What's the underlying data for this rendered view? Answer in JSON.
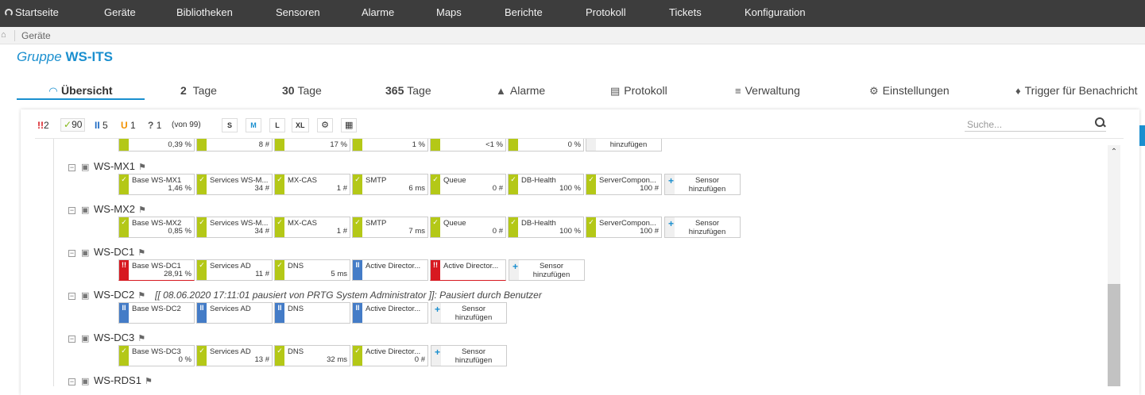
{
  "nav": {
    "home": "Startseite",
    "items": [
      "Geräte",
      "Bibliotheken",
      "Sensoren",
      "Alarme",
      "Maps",
      "Berichte",
      "Protokoll",
      "Tickets",
      "Konfiguration"
    ]
  },
  "breadcrumb": {
    "current": "Geräte"
  },
  "group": {
    "prefix": "Gruppe",
    "name": "WS-ITS"
  },
  "tabs": {
    "overview": "Übersicht",
    "days2_num": "2",
    "days2_label": "Tage",
    "days30_num": "30",
    "days30_label": "Tage",
    "days365_num": "365",
    "days365_label": "Tage",
    "alarms": "Alarme",
    "log": "Protokoll",
    "management": "Verwaltung",
    "settings": "Einstellungen",
    "triggers": "Trigger für Benachricht"
  },
  "toolbar": {
    "down_count": "2",
    "up_count": "90",
    "paused_count": "5",
    "unusual_count": "1",
    "unknown_count": "1",
    "total": "(von 99)",
    "size_s": "S",
    "size_m": "M",
    "size_l": "L",
    "size_xl": "XL",
    "search_placeholder": "Suche..."
  },
  "partial_row": {
    "values": [
      "0,39 %",
      "8 #",
      "17 %",
      "1 %",
      "<1 %",
      "0 %"
    ],
    "add_label": "hinzufügen"
  },
  "add_sensor": {
    "line1": "Sensor",
    "line2": "hinzufügen"
  },
  "devices": {
    "mx1": {
      "name": "WS-MX1",
      "sensors": [
        {
          "name": "Base WS-MX1",
          "value": "1,46 %"
        },
        {
          "name": "Services WS-M...",
          "value": "34 #"
        },
        {
          "name": "MX-CAS",
          "value": "1 #"
        },
        {
          "name": "SMTP",
          "value": "6 ms"
        },
        {
          "name": "Queue",
          "value": "0 #"
        },
        {
          "name": "DB-Health",
          "value": "100 %"
        },
        {
          "name": "ServerCompon...",
          "value": "100 #"
        }
      ]
    },
    "mx2": {
      "name": "WS-MX2",
      "sensors": [
        {
          "name": "Base WS-MX2",
          "value": "0,85 %"
        },
        {
          "name": "Services WS-M...",
          "value": "34 #"
        },
        {
          "name": "MX-CAS",
          "value": "1 #"
        },
        {
          "name": "SMTP",
          "value": "7 ms"
        },
        {
          "name": "Queue",
          "value": "0 #"
        },
        {
          "name": "DB-Health",
          "value": "100 %"
        },
        {
          "name": "ServerCompon...",
          "value": "100 #"
        }
      ]
    },
    "dc1": {
      "name": "WS-DC1",
      "sensors": [
        {
          "name": "Base WS-DC1",
          "value": "28,91 %"
        },
        {
          "name": "Services AD",
          "value": "11 #"
        },
        {
          "name": "DNS",
          "value": "5 ms"
        },
        {
          "name": "Active Director...",
          "value": ""
        },
        {
          "name": "Active Director...",
          "value": ""
        }
      ]
    },
    "dc2": {
      "name": "WS-DC2",
      "paused_msg": "[[ 08.06.2020 17:11:01 pausiert von PRTG System Administrator ]]: Pausiert durch Benutzer",
      "sensors": [
        {
          "name": "Base WS-DC2",
          "value": ""
        },
        {
          "name": "Services AD",
          "value": ""
        },
        {
          "name": "DNS",
          "value": ""
        },
        {
          "name": "Active Director...",
          "value": ""
        }
      ]
    },
    "dc3": {
      "name": "WS-DC3",
      "sensors": [
        {
          "name": "Base WS-DC3",
          "value": "0 %"
        },
        {
          "name": "Services AD",
          "value": "13 #"
        },
        {
          "name": "DNS",
          "value": "32 ms"
        },
        {
          "name": "Active Director...",
          "value": "0 #"
        }
      ]
    },
    "rds1": {
      "name": "WS-RDS1"
    }
  },
  "colors": {
    "up": "#b4c817",
    "down": "#d71920",
    "paused": "#447cc7",
    "accent": "#1a8fcf",
    "nav_bg": "#3d3d3d"
  }
}
